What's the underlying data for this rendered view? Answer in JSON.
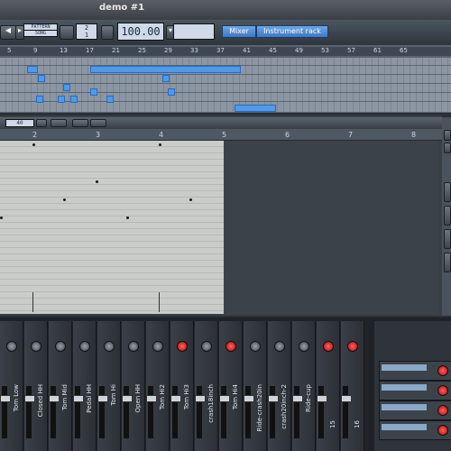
{
  "window": {
    "title": "demo #1"
  },
  "toolbar": {
    "tempo_value": "100.00",
    "panel_buttons": [
      "Mixer",
      "Instrument rack"
    ],
    "lcd_small": [
      "PATTERN",
      "SONG",
      "2",
      "1"
    ],
    "colors": {
      "accent": "#4f9ae9",
      "mixer_bg": "#1f2328"
    }
  },
  "song_editor": {
    "ruler": [
      "5",
      "9",
      "13",
      "17",
      "21",
      "25",
      "29",
      "33",
      "37",
      "41",
      "45",
      "49",
      "53",
      "57",
      "61",
      "65"
    ]
  },
  "piano_roll": {
    "toolbar_text": "40",
    "ruler": [
      "2",
      "3",
      "4",
      "5",
      "6",
      "7",
      "8"
    ]
  },
  "mixer": {
    "channels": [
      "Tom Low",
      "Closed HH",
      "Tom Mid",
      "Pedal HH",
      "Tom Hi",
      "Open HH",
      "Tom Hi2",
      "Tom Hi3",
      "crash18inch",
      "Tom Hi4",
      "Ride-crash20in",
      "crash20inch-2",
      "Ride-cup",
      "15",
      "16"
    ],
    "fx_rack": [
      "",
      "",
      "",
      ""
    ]
  }
}
